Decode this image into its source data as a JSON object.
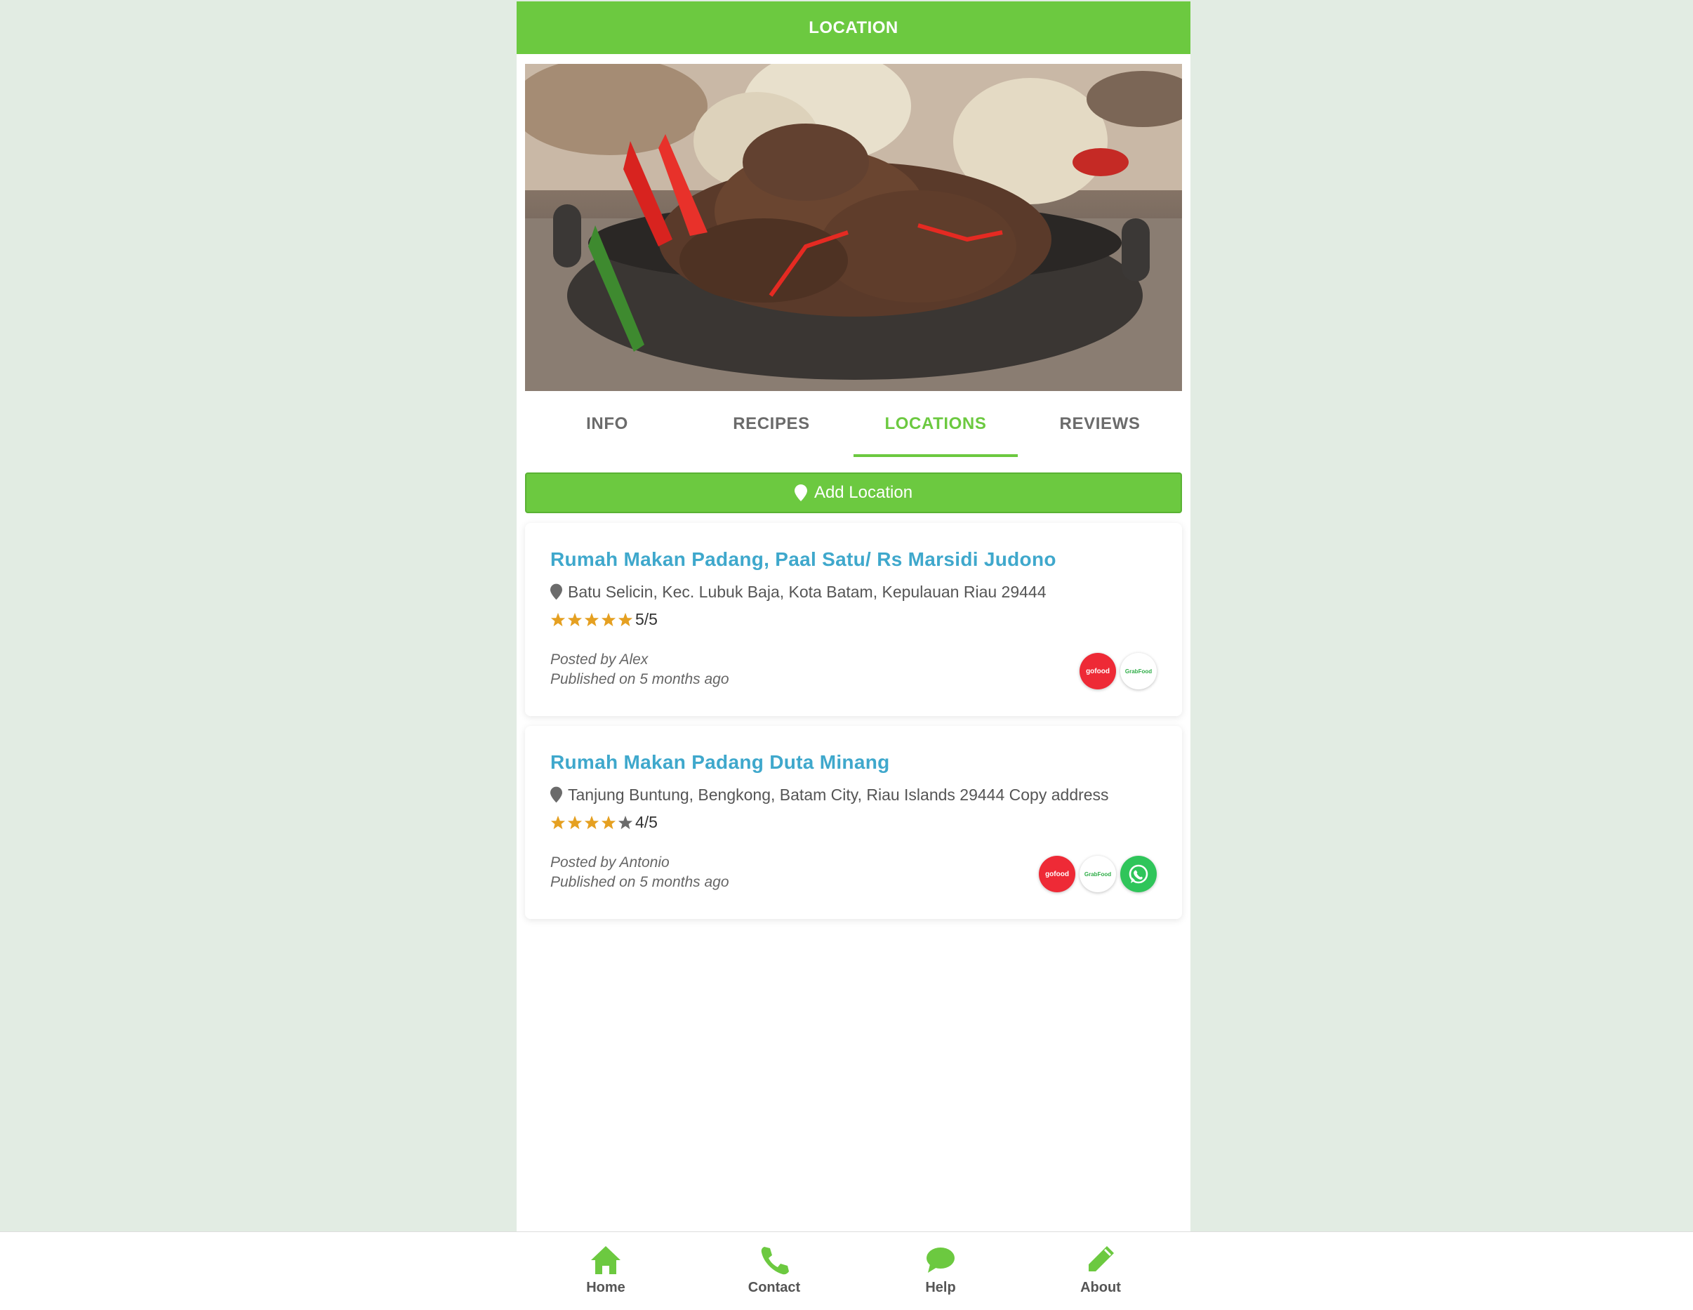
{
  "header": {
    "title": "LOCATION"
  },
  "tabs": [
    {
      "label": "INFO",
      "active": false
    },
    {
      "label": "RECIPES",
      "active": false
    },
    {
      "label": "LOCATIONS",
      "active": true
    },
    {
      "label": "REVIEWS",
      "active": false
    }
  ],
  "add_location": {
    "label": "Add Location",
    "icon": "map-marker-icon"
  },
  "locations": [
    {
      "name": "Rumah Makan Padang, Paal Satu/ Rs Marsidi Judono",
      "address": "Batu Selicin, Kec. Lubuk Baja, Kota Batam, Kepulauan Riau 29444",
      "rating_text": "5/5",
      "rating": 5,
      "posted_by": "Posted by Alex",
      "published": "Published on 5 months ago",
      "services": [
        {
          "name": "gofood",
          "label": "gofood"
        },
        {
          "name": "grabfood",
          "label": "GrabFood"
        }
      ]
    },
    {
      "name": "Rumah Makan Padang Duta Minang",
      "address": "Tanjung Buntung, Bengkong, Batam City, Riau Islands 29444 Copy address",
      "rating_text": "4/5",
      "rating": 4,
      "posted_by": "Posted by Antonio",
      "published": "Published on 5 months ago",
      "services": [
        {
          "name": "gofood",
          "label": "gofood"
        },
        {
          "name": "grabfood",
          "label": "GrabFood"
        },
        {
          "name": "whatsapp",
          "label": ""
        }
      ]
    }
  ],
  "bottom_nav": [
    {
      "label": "Home",
      "icon": "home-icon"
    },
    {
      "label": "Contact",
      "icon": "phone-icon"
    },
    {
      "label": "Help",
      "icon": "chat-icon"
    },
    {
      "label": "About",
      "icon": "pencil-icon"
    }
  ],
  "colors": {
    "accent": "#6cc940",
    "title": "#3fa8cc",
    "star": "#e5a021",
    "star_empty": "#6b6b6b"
  }
}
